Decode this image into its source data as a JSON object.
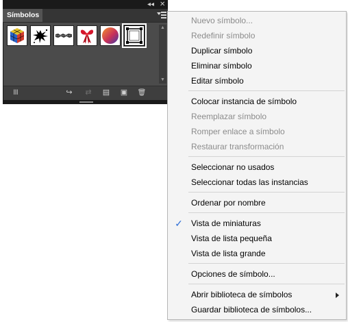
{
  "panel": {
    "tab_label": "Símbolos",
    "collapse_glyph": "◂◂",
    "close_glyph": "✕",
    "symbols": [
      {
        "name": "cube-symbol"
      },
      {
        "name": "splat-symbol"
      },
      {
        "name": "grunge-brush-symbol"
      },
      {
        "name": "ribbon-symbol"
      },
      {
        "name": "gradient-sphere-symbol"
      },
      {
        "name": "frame-symbol",
        "selected": true
      }
    ],
    "toolbar": {
      "library_glyph": "lll",
      "place_glyph": "↪",
      "break_link_glyph": "⇄",
      "options_glyph": "▤",
      "new_glyph": "▣",
      "delete_glyph": "🗑"
    }
  },
  "menu": {
    "check_glyph": "✓",
    "items": [
      {
        "label": "Nuevo símbolo...",
        "enabled": false
      },
      {
        "label": "Redefinir símbolo",
        "enabled": false
      },
      {
        "label": "Duplicar símbolo",
        "enabled": true
      },
      {
        "label": "Eliminar símbolo",
        "enabled": true
      },
      {
        "label": "Editar símbolo",
        "enabled": true
      },
      {
        "label": "Colocar instancia de símbolo",
        "enabled": true
      },
      {
        "label": "Reemplazar símbolo",
        "enabled": false
      },
      {
        "label": "Romper enlace a símbolo",
        "enabled": false
      },
      {
        "label": "Restaurar transformación",
        "enabled": false
      },
      {
        "label": "Seleccionar no usados",
        "enabled": true
      },
      {
        "label": "Seleccionar todas las instancias",
        "enabled": true
      },
      {
        "label": "Ordenar por nombre",
        "enabled": true
      },
      {
        "label": "Vista de miniaturas",
        "enabled": true,
        "checked": true
      },
      {
        "label": "Vista de lista pequeña",
        "enabled": true
      },
      {
        "label": "Vista de lista grande",
        "enabled": true
      },
      {
        "label": "Opciones de símbolo...",
        "enabled": true
      },
      {
        "label": "Abrir biblioteca de símbolos",
        "enabled": true,
        "submenu": true
      },
      {
        "label": "Guardar biblioteca de símbolos...",
        "enabled": true
      }
    ]
  },
  "colors": {
    "check": "#2f6fd6",
    "disabled_text": "#8b8b8b",
    "panel_bg": "#4b4b4b"
  }
}
